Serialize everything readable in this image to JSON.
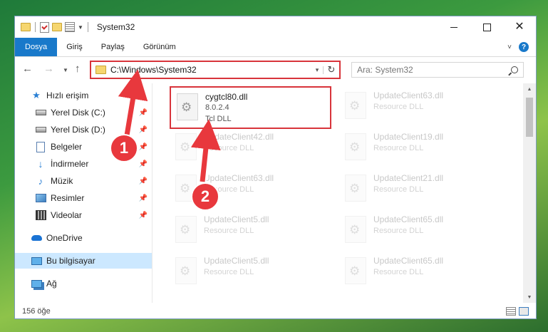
{
  "window": {
    "title": "System32"
  },
  "ribbon": {
    "tabs": [
      "Dosya",
      "Giriş",
      "Paylaş",
      "Görünüm"
    ],
    "help": "?"
  },
  "address": {
    "path": "C:\\Windows\\System32"
  },
  "search": {
    "placeholder": "Ara: System32"
  },
  "sidebar": {
    "items": [
      {
        "label": "Hızlı erişim",
        "icon": "star-icon",
        "pinned": false
      },
      {
        "label": "Yerel Disk (C:)",
        "icon": "drive-icon",
        "pinned": true
      },
      {
        "label": "Yerel Disk (D:)",
        "icon": "drive-icon",
        "pinned": true
      },
      {
        "label": "Belgeler",
        "icon": "documents-icon",
        "pinned": true
      },
      {
        "label": "İndirmeler",
        "icon": "downloads-icon",
        "pinned": true
      },
      {
        "label": "Müzik",
        "icon": "music-icon",
        "pinned": true
      },
      {
        "label": "Resimler",
        "icon": "pictures-icon",
        "pinned": true
      },
      {
        "label": "Videolar",
        "icon": "videos-icon",
        "pinned": true
      },
      {
        "label": "OneDrive",
        "icon": "onedrive-icon",
        "pinned": false
      },
      {
        "label": "Bu bilgisayar",
        "icon": "this-pc-icon",
        "pinned": false
      },
      {
        "label": "Ağ",
        "icon": "network-icon",
        "pinned": false
      }
    ]
  },
  "files": {
    "highlighted": {
      "name": "cygtcl80.dll",
      "version": "8.0.2.4",
      "type": "Tcl DLL"
    },
    "faded": [
      {
        "name": "UpdateClient63.dll",
        "type": "Resource DLL"
      },
      {
        "name": "UpdateClient42.dll",
        "type": "Resource DLL"
      },
      {
        "name": "UpdateClient19.dll",
        "type": "Resource DLL"
      },
      {
        "name": "UpdateClient63.dll",
        "type": "Resource DLL"
      },
      {
        "name": "UpdateClient21.dll",
        "type": "Resource DLL"
      },
      {
        "name": "UpdateClient5.dll",
        "type": "Resource DLL"
      },
      {
        "name": "UpdateClient65.dll",
        "type": "Resource DLL"
      },
      {
        "name": "UpdateClient5.dll",
        "type": "Resource DLL"
      },
      {
        "name": "UpdateClient65.dll",
        "type": "Resource DLL"
      }
    ]
  },
  "status": {
    "count": "156 öğe"
  },
  "annotations": {
    "badge1": "1",
    "badge2": "2",
    "color": "#e8383d"
  }
}
